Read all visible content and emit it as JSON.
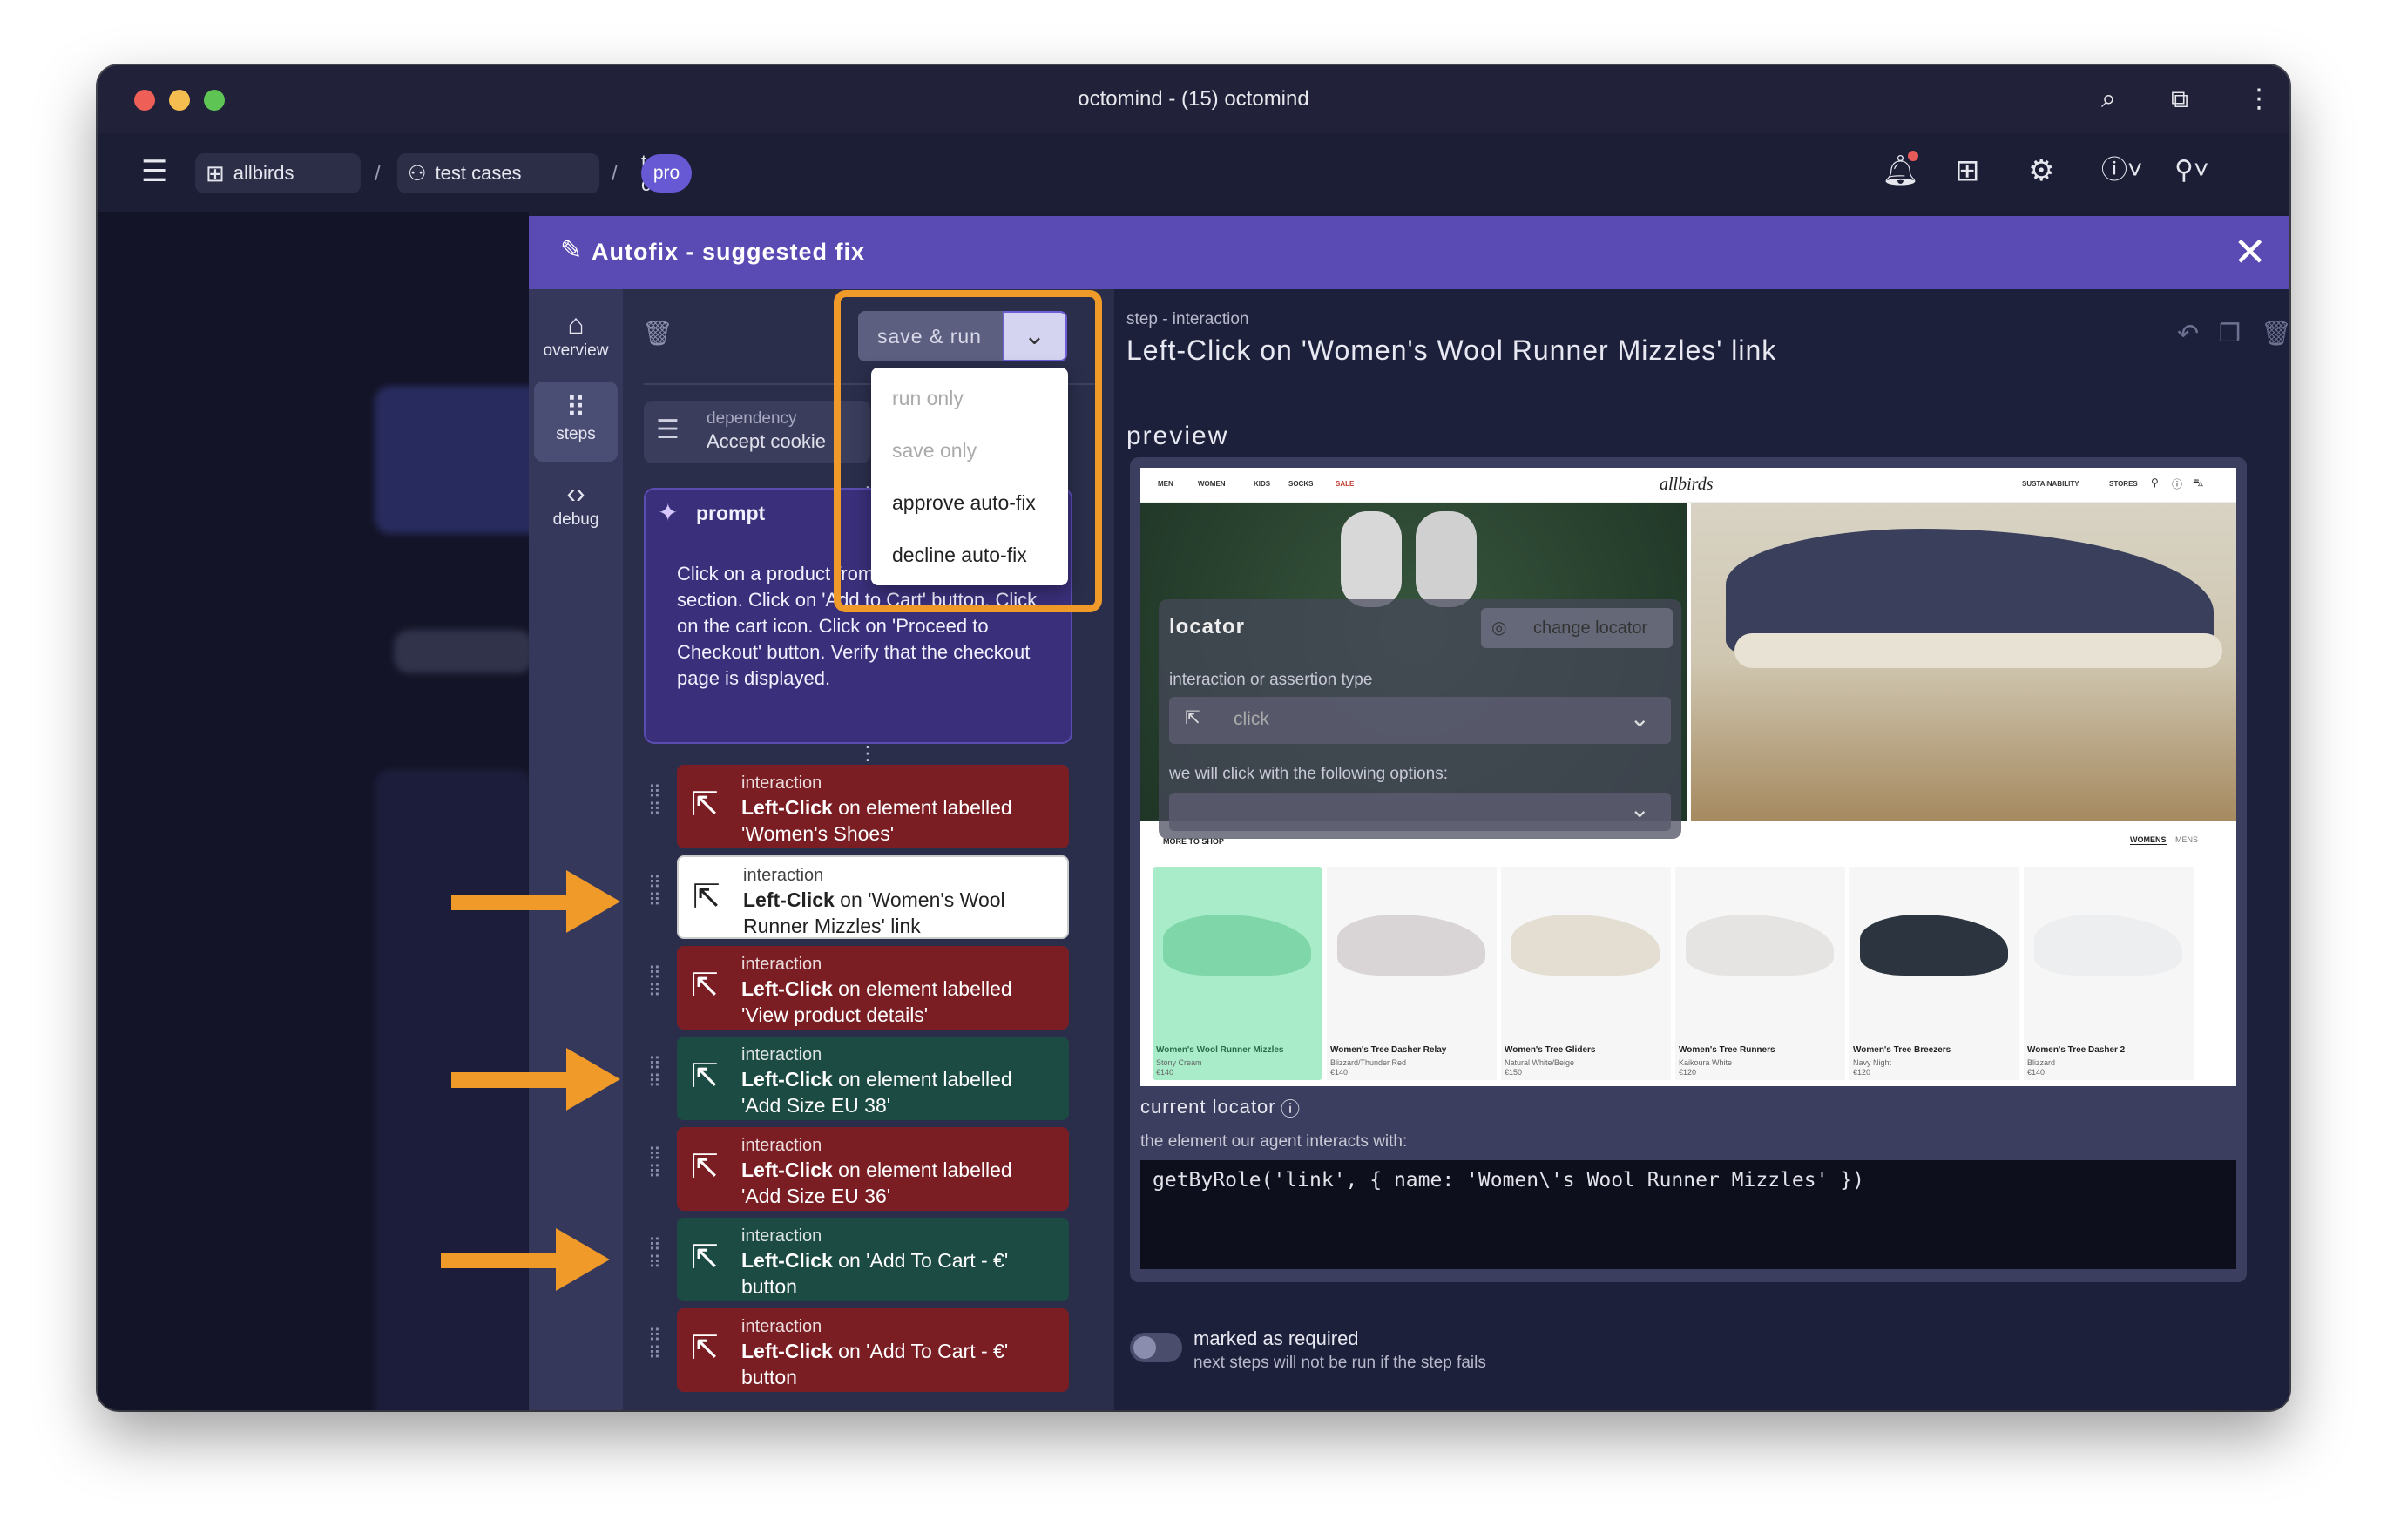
{
  "window": {
    "title": "octomind - (15) octomind"
  },
  "breadcrumb": {
    "project": "allbirds",
    "section": "test cases",
    "page": "test case",
    "badge": "pro"
  },
  "modal": {
    "title": "Autofix - suggested fix"
  },
  "rail": [
    {
      "label": "overview",
      "icon": "home-icon"
    },
    {
      "label": "steps",
      "icon": "footsteps-icon"
    },
    {
      "label": "debug",
      "icon": "code-icon"
    }
  ],
  "save_run": {
    "label": "save & run",
    "options": [
      "run only",
      "save only",
      "approve auto-fix",
      "decline auto-fix"
    ]
  },
  "dependency": {
    "type": "dependency",
    "label": "Accept cookie"
  },
  "prompt": {
    "title": "prompt",
    "text": "Click on a product from the 'Featured' section. Click on 'Add to Cart' button. Click on the cart icon. Click on 'Proceed to Checkout' button. Verify that the checkout page is displayed."
  },
  "steps": [
    {
      "type": "interaction",
      "action": "Left-Click",
      "rest": " on element labelled",
      "target": "'Women's Shoes'",
      "status": "failed"
    },
    {
      "type": "interaction",
      "action": "Left-Click",
      "rest": " on 'Women's Wool",
      "target": "Runner Mizzles' link",
      "status": "selected"
    },
    {
      "type": "interaction",
      "action": "Left-Click",
      "rest": " on element labelled",
      "target": "'View product details'",
      "status": "failed"
    },
    {
      "type": "interaction",
      "action": "Left-Click",
      "rest": " on element labelled",
      "target": "'Add Size EU 38'",
      "status": "passed"
    },
    {
      "type": "interaction",
      "action": "Left-Click",
      "rest": " on element labelled",
      "target": "'Add Size EU 36'",
      "status": "failed"
    },
    {
      "type": "interaction",
      "action": "Left-Click",
      "rest": " on 'Add To Cart - €'",
      "target": "button",
      "status": "passed"
    },
    {
      "type": "interaction",
      "action": "Left-Click",
      "rest": " on 'Add To Cart - €'",
      "target": "button",
      "status": "failed"
    }
  ],
  "detail": {
    "kind": "step - interaction",
    "title": "Left-Click on 'Women's Wool Runner Mizzles' link",
    "preview_label": "preview",
    "current_locator_label": "current locator",
    "interacts_label": "the element our agent interacts with:",
    "code": "getByRole('link', { name: 'Women\\'s Wool Runner Mizzles' })",
    "required_label": "marked as required",
    "required_hint": "next steps will not be run if the step fails"
  },
  "locator_overlay": {
    "title": "locator",
    "change_button": "change locator",
    "type_label": "interaction or assertion type",
    "type_value": "click",
    "options_label": "we will click with the following options:"
  },
  "site": {
    "logo": "allbirds",
    "nav": [
      "MEN",
      "WOMEN",
      "KIDS",
      "SOCKS",
      "SALE"
    ],
    "nav_right": [
      "SUSTAINABILITY",
      "STORES"
    ],
    "more_to_shop": "MORE TO SHOP",
    "tabs": [
      "WOMENS",
      "MENS"
    ],
    "products": [
      {
        "name": "Women's Wool Runner Mizzles",
        "color": "Stony Cream",
        "price": "€140",
        "shoe": "#9ee0bd"
      },
      {
        "name": "Women's Tree Dasher Relay",
        "color": "Blizzard/Thunder Red",
        "price": "€140",
        "shoe": "#d9d4d6"
      },
      {
        "name": "Women's Tree Gliders",
        "color": "Natural White/Beige",
        "price": "€150",
        "shoe": "#e3ddd2"
      },
      {
        "name": "Women's Tree Runners",
        "color": "Kaikoura White",
        "price": "€120",
        "shoe": "#e6e4e2"
      },
      {
        "name": "Women's Tree Breezers",
        "color": "Navy Night",
        "price": "€120",
        "shoe": "#2c3440"
      },
      {
        "name": "Women's Tree Dasher 2",
        "color": "Blizzard",
        "price": "€140",
        "shoe": "#eceef0"
      }
    ]
  },
  "colors": {
    "accent": "#5a4ab4",
    "failed": "#7b1e24",
    "passed": "#1c4b44",
    "highlight": "#f09a2a"
  }
}
